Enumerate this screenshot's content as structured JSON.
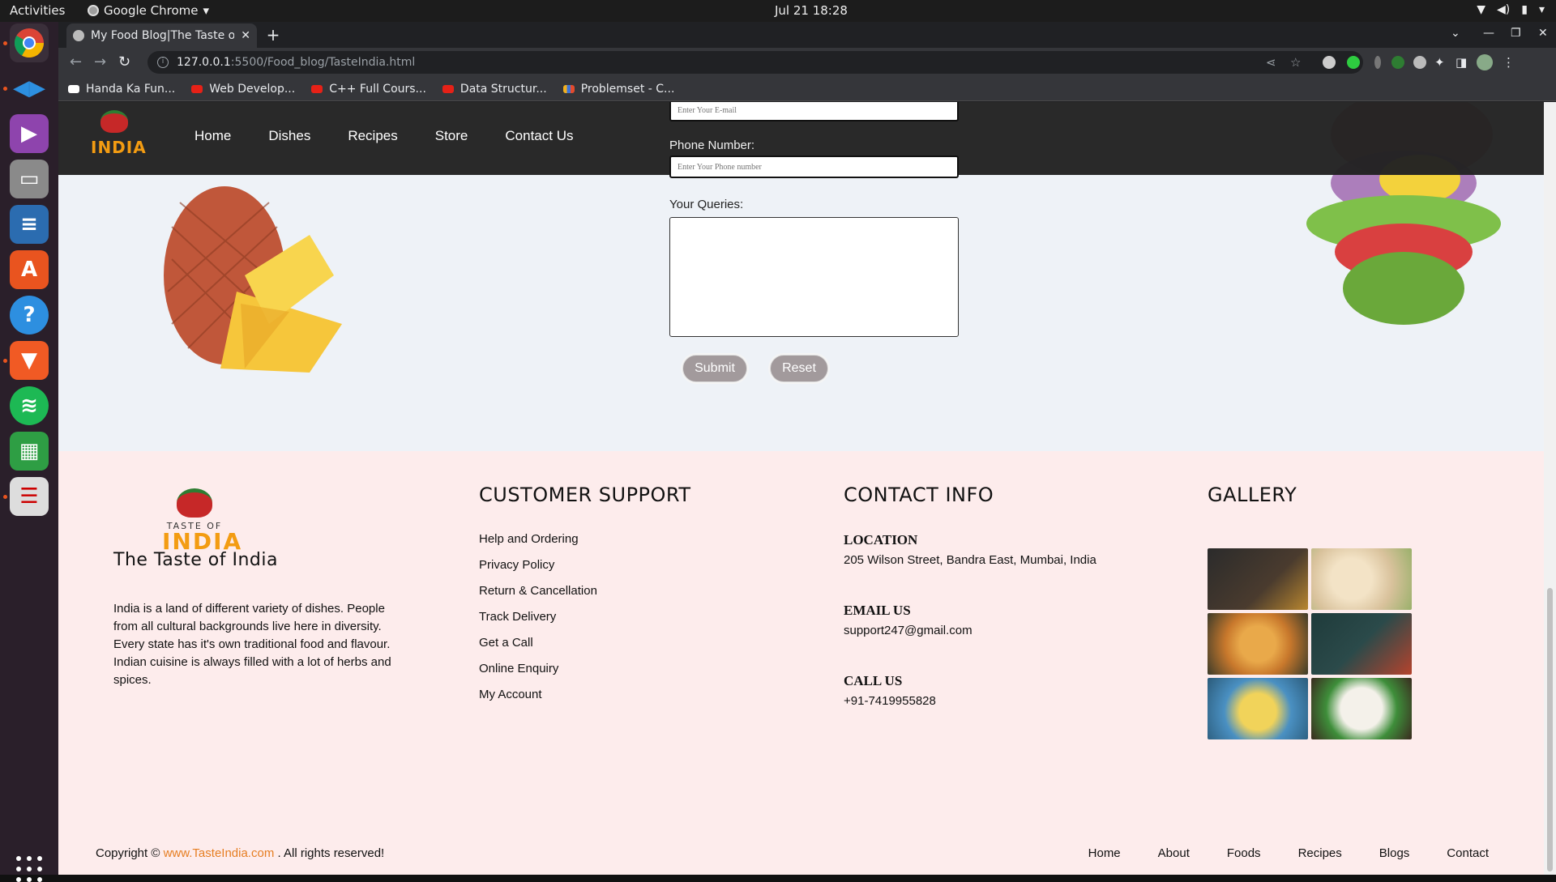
{
  "topbar": {
    "activities": "Activities",
    "app": "Google Chrome",
    "clock": "Jul 21  18:28"
  },
  "browser": {
    "tab_title": "My Food Blog|The Taste o",
    "url_host": "127.0.0.1",
    "url_path": ":5500/Food_blog/TasteIndia.html",
    "bookmarks": [
      "Handa Ka Fun...",
      "Web Develop...",
      "C++ Full Cours...",
      "Data Structur...",
      "Problemset - C..."
    ]
  },
  "site": {
    "logo_text": "INDIA",
    "nav": [
      "Home",
      "Dishes",
      "Recipes",
      "Store",
      "Contact Us"
    ]
  },
  "form": {
    "email_placeholder": "Enter Your E-mail",
    "phone_label": "Phone Number:",
    "phone_placeholder": "Enter Your Phone number",
    "queries_label": "Your Queries:",
    "submit": "Submit",
    "reset": "Reset"
  },
  "footer": {
    "brand": {
      "logo_small": "TASTE OF",
      "logo_big": "INDIA",
      "name": "The Taste of India",
      "description": "India is a land of different variety of dishes. People from all cultural backgrounds live here in diversity. Every state has it's own traditional food and flavour. Indian cuisine is always filled with a lot of herbs and spices."
    },
    "support": {
      "heading": "CUSTOMER SUPPORT",
      "links": [
        "Help and Ordering",
        "Privacy Policy",
        "Return & Cancellation",
        "Track Delivery",
        "Get a Call",
        "Online Enquiry",
        "My Account"
      ]
    },
    "contact": {
      "heading": "CONTACT INFO",
      "location_label": "LOCATION",
      "location": "205 Wilson Street, Bandra East, Mumbai, India",
      "email_label": "EMAIL US",
      "email": "support247@gmail.com",
      "call_label": "CALL US",
      "phone": "+91-7419955828"
    },
    "gallery": {
      "heading": "GALLERY"
    },
    "copyright_prefix": "Copyright ©",
    "copyright_site": "www.TasteIndia.com",
    "copyright_suffix": ". All rights reserved!",
    "bottom_nav": [
      "Home",
      "About",
      "Foods",
      "Recipes",
      "Blogs",
      "Contact"
    ]
  },
  "colors": {
    "accent": "#e67e22",
    "footer_bg": "#fdecec",
    "header_bg": "#222222",
    "button": "#a29a9c"
  }
}
